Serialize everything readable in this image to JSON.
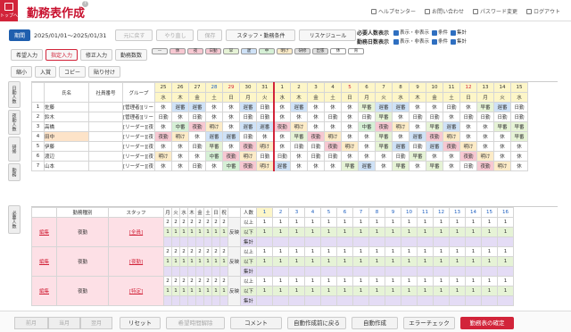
{
  "top": {
    "label": "トップへ",
    "title": "勤務表作成",
    "help_center": "ヘルプセンター",
    "contact": "お問い合わせ",
    "password": "パスワード変更",
    "logout": "ログアウト"
  },
  "toolbar": {
    "period_btn": "期間",
    "period": "2025/01/01〜2025/01/31",
    "undo": "元に戻す",
    "redo": "やり直し",
    "save": "保存",
    "staff_filter": "スタッフ・勤務条件",
    "schedule": "リスケジュール"
  },
  "counts": {
    "required_label": "必要人数表示",
    "workdays_label": "勤務日数表示",
    "show_hide": "表示・非表示",
    "condition": "条件",
    "total": "集計"
  },
  "row2": {
    "hope": "希望入力",
    "designate": "指定入力",
    "correct": "修正入力",
    "change": "勤務数数"
  },
  "row3": [
    "縮小",
    "入賞",
    "コピー",
    "貼り付け"
  ],
  "legend": [
    "—",
    "休",
    "夜",
    "日勤",
    "早",
    "遅",
    "中",
    "明け",
    "研修",
    "出張",
    "休",
    "育"
  ],
  "side": {
    "a": "日勤人数",
    "b": "夜勤人数",
    "c": "研修",
    "d": "勤務"
  },
  "cols": {
    "no": "",
    "name": "氏名",
    "emp": "社員番号",
    "group": "グループ"
  },
  "dates": [
    "25",
    "26",
    "27",
    "28",
    "29",
    "30",
    "31",
    "1",
    "2",
    "3",
    "4",
    "5",
    "6",
    "7",
    "8",
    "9",
    "10",
    "11",
    "12",
    "13",
    "14",
    "15"
  ],
  "dows": [
    "水",
    "木",
    "金",
    "土",
    "日",
    "月",
    "火",
    "水",
    "木",
    "金",
    "土",
    "日",
    "月",
    "火",
    "水",
    "木",
    "金",
    "土",
    "日",
    "月",
    "火",
    "水"
  ],
  "staff": [
    {
      "no": "1",
      "name": "佐藤",
      "group": "[管理者][リー",
      "shifts": [
        "休",
        "遅番",
        "遅番",
        "休",
        "休",
        "遅番",
        "日勤",
        "休",
        "遅番",
        "休",
        "休",
        "休",
        "早番",
        "遅番",
        "遅番",
        "休",
        "休",
        "日勤",
        "休",
        "早番",
        "遅番",
        "日勤"
      ]
    },
    {
      "no": "2",
      "name": "鈴木",
      "group": "[管理者][リー",
      "shifts": [
        "日勤",
        "休",
        "日勤",
        "休",
        "休",
        "日勤",
        "日勤",
        "休",
        "休",
        "休",
        "日勤",
        "休",
        "日勤",
        "早番",
        "休",
        "日勤",
        "日勤",
        "休",
        "日勤",
        "日勤",
        "日勤",
        "日勤"
      ]
    },
    {
      "no": "3",
      "name": "高橋",
      "group": "[リーダー][夜",
      "shifts": [
        "休",
        "中番",
        "夜勤",
        "明け",
        "休",
        "遅番",
        "遅番",
        "夜勤",
        "明け",
        "休",
        "休",
        "休",
        "中番",
        "夜勤",
        "明け",
        "休",
        "早番",
        "遅番",
        "休",
        "休",
        "早番",
        "早番"
      ]
    },
    {
      "no": "4",
      "name": "田中",
      "group": "[リーダー][夜",
      "shifts": [
        "夜勤",
        "明け",
        "休",
        "遅番",
        "遅番",
        "日勤",
        "休",
        "休",
        "早番",
        "夜勤",
        "明け",
        "休",
        "休",
        "早番",
        "休",
        "遅番",
        "夜勤",
        "明け",
        "休",
        "休",
        "休",
        "早番"
      ]
    },
    {
      "no": "5",
      "name": "伊藤",
      "group": "[リーダー][夜",
      "shifts": [
        "休",
        "休",
        "日勤",
        "早番",
        "休",
        "夜勤",
        "明け",
        "休",
        "日勤",
        "日勤",
        "夜勤",
        "明け",
        "休",
        "早番",
        "遅番",
        "日勤",
        "遅番",
        "夜勤",
        "明け",
        "休",
        "休",
        "休"
      ]
    },
    {
      "no": "6",
      "name": "渡辺",
      "group": "[リーダー][夜",
      "shifts": [
        "明け",
        "休",
        "休",
        "中番",
        "夜勤",
        "明け",
        "日勤",
        "日勤",
        "休",
        "日勤",
        "日勤",
        "休",
        "休",
        "休",
        "日勤",
        "早番",
        "休",
        "休",
        "夜勤",
        "明け",
        "休",
        "休"
      ]
    },
    {
      "no": "7",
      "name": "山本",
      "group": "[リーダー][夜",
      "shifts": [
        "休",
        "休",
        "日勤",
        "休",
        "中番",
        "夜勤",
        "明け",
        "遅番",
        "休",
        "休",
        "休",
        "早番",
        "遅番",
        "休",
        "早番",
        "休",
        "早番",
        "休",
        "日勤",
        "夜勤",
        "明け",
        "休"
      ]
    }
  ],
  "sec2": {
    "header_type": "勤務種別",
    "header_staff": "スタッフ",
    "days": [
      "月",
      "火",
      "水",
      "木",
      "金",
      "土",
      "日",
      "祝"
    ],
    "count_label": "人数",
    "rows": [
      {
        "edit": "編集",
        "type": "夜勤",
        "staff": "[全員]",
        "reflect": "反映"
      },
      {
        "edit": "編集",
        "type": "夜勤",
        "staff": "[夜勤]",
        "reflect": "反映"
      },
      {
        "edit": "編集",
        "type": "夜勤",
        "staff": "[特定]",
        "reflect": "反映"
      }
    ],
    "sub": [
      "以上",
      "以下",
      "集計"
    ],
    "nums": [
      "1",
      "2",
      "3",
      "4",
      "5",
      "6",
      "7",
      "8",
      "9",
      "10",
      "11",
      "12",
      "13",
      "14",
      "15",
      "16"
    ]
  },
  "footer": {
    "prev": "前月",
    "cur": "当月",
    "next": "翌月",
    "reset": "リセット",
    "release": "希望時間解除",
    "comment": "コメント",
    "back": "自動作成前に戻る",
    "auto": "自動作成",
    "check": "エラーチェック",
    "confirm": "勤務表の確定"
  }
}
